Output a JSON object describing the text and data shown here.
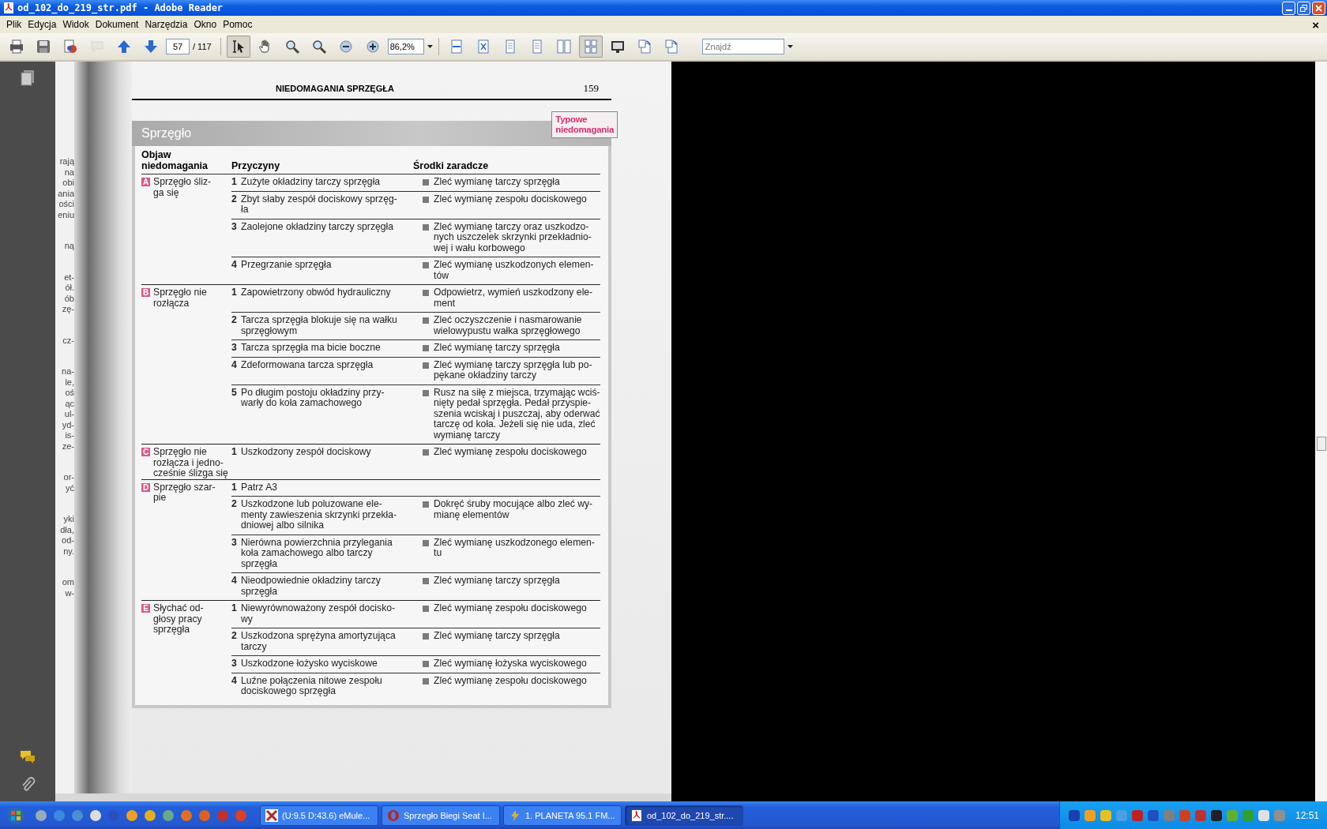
{
  "window": {
    "title": "od_102_do_219_str.pdf - Adobe Reader"
  },
  "menu": [
    "Plik",
    "Edycja",
    "Widok",
    "Dokument",
    "Narzędzia",
    "Okno",
    "Pomoc"
  ],
  "document_close": "×",
  "toolbar": {
    "tools": [
      {
        "kind": "print",
        "selected": false,
        "disabled": false
      },
      {
        "kind": "save",
        "selected": false,
        "disabled": false
      },
      {
        "kind": "export",
        "selected": false,
        "disabled": false
      },
      {
        "kind": "comment",
        "selected": false,
        "disabled": true
      },
      {
        "kind": "prev",
        "selected": false,
        "disabled": false
      },
      {
        "kind": "next",
        "selected": false,
        "disabled": false
      }
    ],
    "page": "57",
    "page_total": "/ 117",
    "tools2": [
      {
        "kind": "select",
        "selected": true,
        "disabled": false
      },
      {
        "kind": "hand",
        "selected": false,
        "disabled": false
      },
      {
        "kind": "marquee",
        "selected": false,
        "disabled": false
      },
      {
        "kind": "zoomtool",
        "selected": false,
        "disabled": false
      },
      {
        "kind": "zoomout",
        "selected": false,
        "disabled": false
      },
      {
        "kind": "zoomin",
        "selected": false,
        "disabled": false
      }
    ],
    "zoom": "86,2%",
    "tools3": [
      {
        "kind": "fitwidth",
        "selected": false,
        "disabled": false
      },
      {
        "kind": "fitpage",
        "selected": false,
        "disabled": false
      },
      {
        "kind": "single",
        "selected": false,
        "disabled": false
      },
      {
        "kind": "continuous",
        "selected": false,
        "disabled": false
      },
      {
        "kind": "facing",
        "selected": false,
        "disabled": false
      },
      {
        "kind": "grid",
        "selected": true,
        "disabled": false
      },
      {
        "kind": "fullscreen",
        "selected": false,
        "disabled": false
      },
      {
        "kind": "rotleft",
        "selected": false,
        "disabled": false
      },
      {
        "kind": "rotright",
        "selected": false,
        "disabled": false
      }
    ],
    "search": {
      "placeholder": "Znajdź"
    }
  },
  "document": {
    "left_page_fragments": [
      [
        "rają",
        "na",
        "obi",
        "ania",
        "ości",
        "eniu"
      ],
      [
        "ną"
      ],
      [
        "et-",
        "ół.",
        "ób",
        "zę-"
      ],
      [
        "cz-"
      ],
      [
        "na-",
        "le,",
        "oś",
        "ąc",
        "ul-",
        "yd-",
        "is-",
        "ze-"
      ],
      [
        "or-",
        "yć"
      ],
      [
        "yki",
        "dła,",
        "od-",
        "ny."
      ],
      [
        "om",
        "w-"
      ]
    ],
    "header": "NIEDOMAGANIA SPRZĘGŁA",
    "page_number": "159",
    "section_title": "Sprzęgło",
    "badge": "Typowe\nniedomagania",
    "columns": [
      "Objaw\nniedomagania",
      "Przyczyny",
      "Środki zaradcze"
    ],
    "groups": [
      {
        "letter": "A",
        "symptom": "Sprzęgło śliz-\nga się",
        "causes": [
          {
            "number": "1",
            "cause": "Zużyte okładziny tarczy sprzęgła",
            "remedy": "Zleć wymianę tarczy sprzęgła"
          },
          {
            "number": "2",
            "cause": "Zbyt słaby zespół dociskowy sprzęg-\nła",
            "remedy": "Zleć wymianę zespołu dociskowego"
          },
          {
            "number": "3",
            "cause": "Zaolejone okładziny tarczy sprzęgła",
            "remedy": "Zleć wymianę tarczy oraz uszkodzo-\nnych uszczelek skrzynki przekładnio-\nwej i wału korbowego"
          },
          {
            "number": "4",
            "cause": "Przegrzanie sprzęgła",
            "remedy": "Zleć wymianę uszkodzonych elemen-\ntów"
          }
        ]
      },
      {
        "letter": "B",
        "symptom": "Sprzęgło nie\nrozłącza",
        "causes": [
          {
            "number": "1",
            "cause": "Zapowietrzony obwód hydrauliczny",
            "remedy": "Odpowietrz, wymień uszkodzony ele-\nment"
          },
          {
            "number": "2",
            "cause": "Tarcza sprzęgła blokuje się na wałku\nsprzęgłowym",
            "remedy": "Zleć oczyszczenie i nasmarowanie\nwielowypustu wałka sprzęgłowego"
          },
          {
            "number": "3",
            "cause": "Tarcza sprzęgła ma bicie boczne",
            "remedy": "Zleć wymianę tarczy sprzęgła"
          },
          {
            "number": "4",
            "cause": "Zdeformowana tarcza sprzęgła",
            "remedy": "Zleć wymianę tarczy sprzęgła lub po-\npękane okładziny tarczy"
          },
          {
            "number": "5",
            "cause": "Po długim postoju okładziny przy-\nwarły do koła zamachowego",
            "remedy": "Rusz na siłę z miejsca, trzymając wciś-\nnięty pedał sprzęgła. Pedał przyspie-\nszenia wciskaj i puszczaj, aby oderwać\ntarczę od koła. Jeżeli się nie uda, zleć\nwymianę tarczy"
          }
        ]
      },
      {
        "letter": "C",
        "symptom": "Sprzęgło nie\nrozłącza i jedno-\ncześnie ślizga się",
        "causes": [
          {
            "number": "1",
            "cause": "Uszkodzony zespół dociskowy",
            "remedy": "Zleć wymianę zespołu dociskowego"
          }
        ]
      },
      {
        "letter": "D",
        "symptom": "Sprzęgło szar-\npie",
        "causes": [
          {
            "number": "1",
            "cause": "Patrz A3"
          },
          {
            "number": "2",
            "cause": "Uszkodzone lub poluzowane ele-\nmenty zawieszenia skrzynki przekła-\ndniowej albo silnika",
            "remedy": "Dokręć śruby mocujące albo zleć wy-\nmianę elementów"
          },
          {
            "number": "3",
            "cause": "Nierówna powierzchnia przylegania\nkoła zamachowego albo tarczy\nsprzęgła",
            "remedy": "Zleć wymianę uszkodzonego elemen-\ntu"
          },
          {
            "number": "4",
            "cause": "Nieodpowiednie okładziny tarczy\nsprzęgła",
            "remedy": "Zleć wymianę tarczy sprzęgła"
          }
        ]
      },
      {
        "letter": "E",
        "symptom": "Słychać od-\ngłosy pracy\nsprzęgła",
        "causes": [
          {
            "number": "1",
            "cause": "Niewyrównoważony zespół docisko-\nwy",
            "remedy": "Zleć wymianę zespołu dociskowego"
          },
          {
            "number": "2",
            "cause": "Uszkodzona sprężyna amortyzująca\ntarczy",
            "remedy": "Zleć wymianę tarczy sprzęgła"
          },
          {
            "number": "3",
            "cause": "Uszkodzone łożysko wyciskowe",
            "remedy": "Zleć wymianę łożyska wyciskowego"
          },
          {
            "number": "4",
            "cause": "Luźne połączenia nitowe zespołu\ndociskowego sprzęgła",
            "remedy": "Zleć wymianę zespołu dociskowego"
          }
        ]
      }
    ]
  },
  "taskbar": {
    "windows": [
      {
        "label": "(U:9.5 D:43.6) eMule...",
        "kind": "mule",
        "selected": false
      },
      {
        "label": "Sprzegło Biegi Seat I...",
        "kind": "opera",
        "selected": false
      },
      {
        "label": "1. PLANETA  95.1 FM...",
        "kind": "winamp",
        "selected": false
      },
      {
        "label": "od_102_do_219_str....",
        "kind": "pdf",
        "selected": true
      }
    ],
    "clock": "12:51"
  }
}
